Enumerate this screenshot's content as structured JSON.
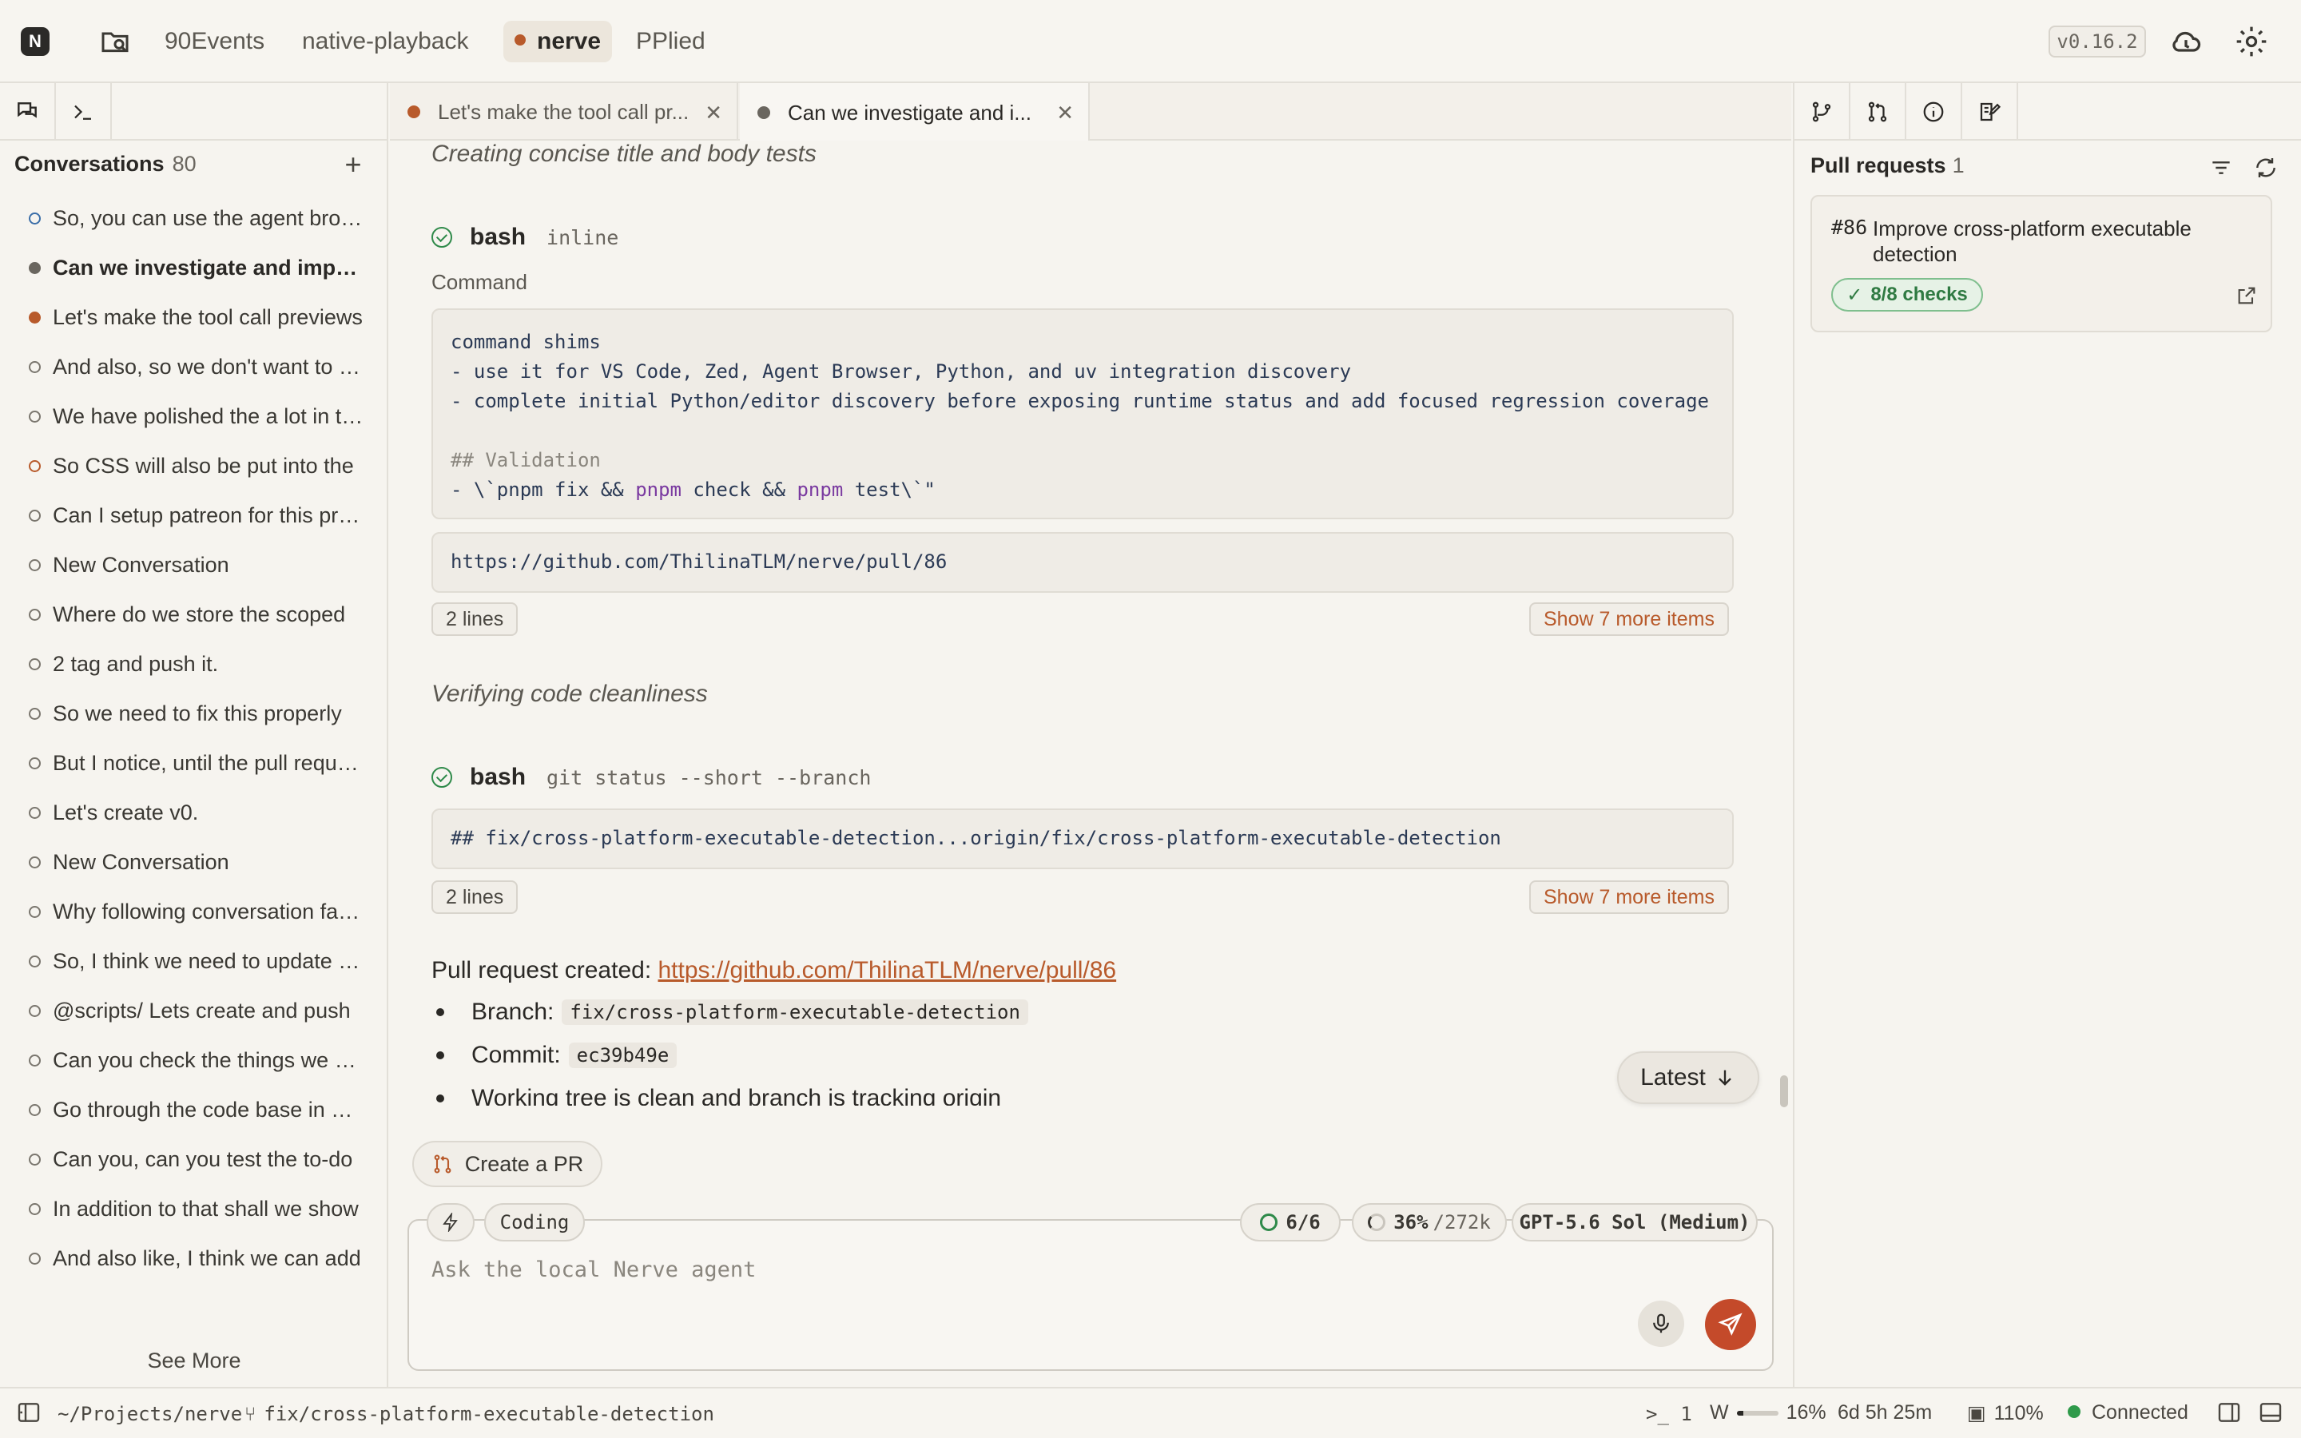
{
  "topbar": {
    "logo": "N",
    "projects": [
      {
        "label": "90Events",
        "active": false
      },
      {
        "label": "native-playback",
        "active": false
      },
      {
        "label": "nerve",
        "active": true
      },
      {
        "label": "PPlied",
        "active": false
      }
    ],
    "version": "v0.16.2"
  },
  "sidebar": {
    "header": "Conversations",
    "count": "80",
    "add_label": "+",
    "conversations": [
      {
        "text": "So, you can use the agent browser to test",
        "bullet": "blue"
      },
      {
        "text": "Can we investigate and improve the",
        "bullet": "filled-gray",
        "active": true
      },
      {
        "text": "Let's make the tool call previews",
        "bullet": "filled-orange"
      },
      {
        "text": "And also, so we don't want to limit",
        "bullet": "gray"
      },
      {
        "text": "We have polished the a lot in the",
        "bullet": "gray"
      },
      {
        "text": "So CSS will also be put into the",
        "bullet": "orange"
      },
      {
        "text": "Can I setup patreon for this project",
        "bullet": "gray"
      },
      {
        "text": "New Conversation",
        "bullet": "gray"
      },
      {
        "text": "Where do we store the scoped",
        "bullet": "gray"
      },
      {
        "text": "2 tag and push it.",
        "bullet": "gray"
      },
      {
        "text": "So we need to fix this properly",
        "bullet": "gray"
      },
      {
        "text": "But I notice, until the pull request",
        "bullet": "gray"
      },
      {
        "text": "Let's create v0.",
        "bullet": "gray"
      },
      {
        "text": "New Conversation",
        "bullet": "gray"
      },
      {
        "text": "Why following conversation failed",
        "bullet": "gray"
      },
      {
        "text": "So, I think we need to update the",
        "bullet": "gray"
      },
      {
        "text": "@scripts/ Lets create and push",
        "bullet": "gray"
      },
      {
        "text": "Can you check the things we can",
        "bullet": "gray"
      },
      {
        "text": "Go through the code base in each",
        "bullet": "gray"
      },
      {
        "text": "Can you, can you test the to-do",
        "bullet": "gray"
      },
      {
        "text": "In addition to that shall we show",
        "bullet": "gray"
      },
      {
        "text": "And also like, I think we can add",
        "bullet": "gray"
      }
    ],
    "see_more": "See More"
  },
  "tabs": [
    {
      "label": "Let's make the tool call pr...",
      "dot_color": "#b85a2b",
      "active": false
    },
    {
      "label": "Can we investigate and i...",
      "dot_color": "#6a665f",
      "active": true
    }
  ],
  "chat": {
    "thinking1": "Creating concise title and body tests",
    "tool1": {
      "name": "bash",
      "arg": "inline"
    },
    "command_label": "Command",
    "code1_lines": [
      {
        "t": "command shims",
        "k": "n"
      },
      {
        "t": "- use it for VS Code, Zed, Agent Browser, Python, and uv integration discovery",
        "k": "n"
      },
      {
        "t": "- complete initial Python/editor discovery before exposing runtime status and add focused regression coverage",
        "k": "n"
      },
      {
        "t": "",
        "k": "n"
      },
      {
        "t": "## Validation",
        "k": "c"
      }
    ],
    "code1_last": {
      "p1": "- \\`",
      "p2": "pnpm fix && ",
      "p3": "pnpm",
      "p4": " check && ",
      "p5": "pnpm",
      "p6": " test\\`\""
    },
    "output1": "https://github.com/ThilinaTLM/nerve/pull/86",
    "lines1": "2 lines",
    "more1": "Show 7 more items",
    "thinking2": "Verifying code cleanliness",
    "tool2": {
      "name": "bash",
      "arg": "git status --short --branch"
    },
    "output2": "## fix/cross-platform-executable-detection...origin/fix/cross-platform-executable-detection",
    "lines2": "2 lines",
    "more2": "Show 7 more items",
    "pr_created_label": "Pull request created:",
    "pr_url": "https://github.com/ThilinaTLM/nerve/pull/86",
    "bullets": [
      {
        "label": "Branch:",
        "code": "fix/cross-platform-executable-detection"
      },
      {
        "label": "Commit:",
        "code": "ec39b49e"
      },
      {
        "label": "Working tree is clean and branch is tracking origin",
        "code": ""
      }
    ],
    "latest": "Latest"
  },
  "composer": {
    "create_pr": "Create a PR",
    "mode": "Coding",
    "tasks": "6/6",
    "context_pct": "36%",
    "context_total": "/272k",
    "model": "GPT-5.6 Sol (Medium)",
    "placeholder": "Ask the local Nerve agent"
  },
  "right": {
    "header": "Pull requests",
    "count": "1",
    "pr": {
      "number": "#86",
      "title": "Improve cross-platform executable detection",
      "checks": "8/8 checks"
    }
  },
  "statusbar": {
    "path": "~/Projects/nerve",
    "branch": "fix/cross-platform-executable-detection",
    "terminals": "1",
    "w_label": "W",
    "w_fraction": 0.16,
    "w_pct": "16%",
    "uptime": "6d 5h 25m",
    "zoom": "110%",
    "connection": "Connected"
  }
}
